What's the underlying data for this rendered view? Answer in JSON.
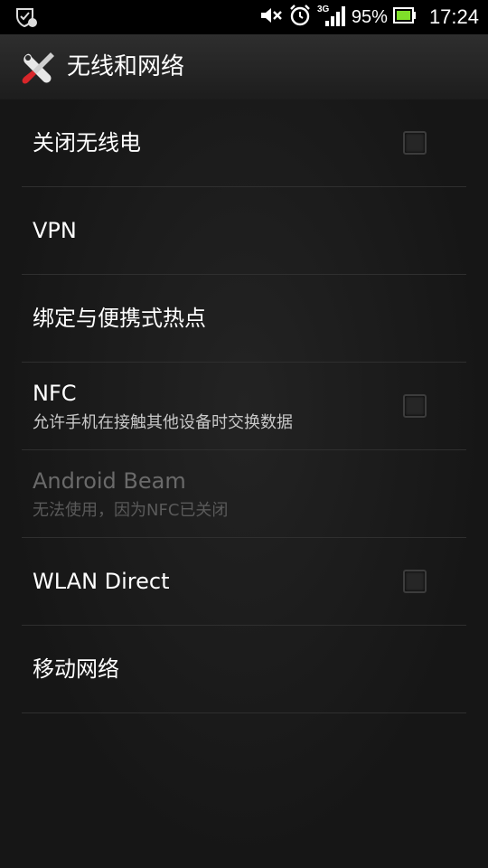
{
  "status_bar": {
    "signal_label": "3G",
    "battery_percent": "95%",
    "time": "17:24"
  },
  "title_bar": {
    "title": "无线和网络",
    "icon": "tools-icon"
  },
  "settings": [
    {
      "title": "关闭无线电",
      "subtitle": "",
      "has_checkbox": true,
      "checked": false,
      "enabled": true
    },
    {
      "title": "VPN",
      "subtitle": "",
      "has_checkbox": false,
      "enabled": true
    },
    {
      "title": "绑定与便携式热点",
      "subtitle": "",
      "has_checkbox": false,
      "enabled": true
    },
    {
      "title": "NFC",
      "subtitle": "允许手机在接触其他设备时交换数据",
      "has_checkbox": true,
      "checked": false,
      "enabled": true
    },
    {
      "title": "Android Beam",
      "subtitle": "无法使用，因为NFC已关闭",
      "has_checkbox": false,
      "enabled": false
    },
    {
      "title": "WLAN Direct",
      "subtitle": "",
      "has_checkbox": true,
      "checked": false,
      "enabled": true
    },
    {
      "title": "移动网络",
      "subtitle": "",
      "has_checkbox": false,
      "enabled": true
    }
  ]
}
